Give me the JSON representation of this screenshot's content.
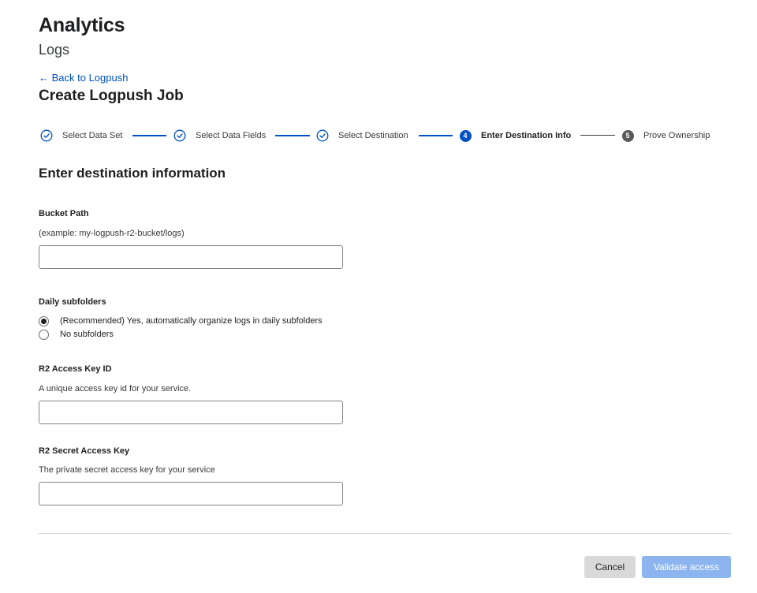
{
  "header": {
    "title": "Analytics",
    "subtitle": "Logs",
    "back_link": "← Back to Logpush",
    "job_title": "Create Logpush Job"
  },
  "stepper": {
    "steps": [
      {
        "label": "Select Data Set",
        "state": "complete",
        "icon": "check-circle-icon"
      },
      {
        "label": "Select Data Fields",
        "state": "complete",
        "icon": "check-circle-icon"
      },
      {
        "label": "Select Destination",
        "state": "complete",
        "icon": "check-circle-icon"
      },
      {
        "label": "Enter Destination Info",
        "state": "current",
        "number": "4"
      },
      {
        "label": "Prove Ownership",
        "state": "pending",
        "number": "5"
      }
    ]
  },
  "form": {
    "section_title": "Enter destination information",
    "bucket_path": {
      "label": "Bucket Path",
      "help": "(example: my-logpush-r2-bucket/logs)",
      "value": ""
    },
    "daily_subfolders": {
      "label": "Daily subfolders",
      "options": [
        {
          "label": "(Recommended) Yes, automatically organize logs in daily subfolders",
          "checked": true
        },
        {
          "label": "No subfolders",
          "checked": false
        }
      ]
    },
    "access_key_id": {
      "label": "R2 Access Key ID",
      "help": "A unique access key id for your service.",
      "value": ""
    },
    "secret_access_key": {
      "label": "R2 Secret Access Key",
      "help": "The private secret access key for your service",
      "value": ""
    }
  },
  "actions": {
    "cancel_label": "Cancel",
    "validate_label": "Validate access"
  },
  "colors": {
    "accent": "#0051c3",
    "validate_disabled": "#8cb4ee",
    "pending_step": "#595959"
  }
}
